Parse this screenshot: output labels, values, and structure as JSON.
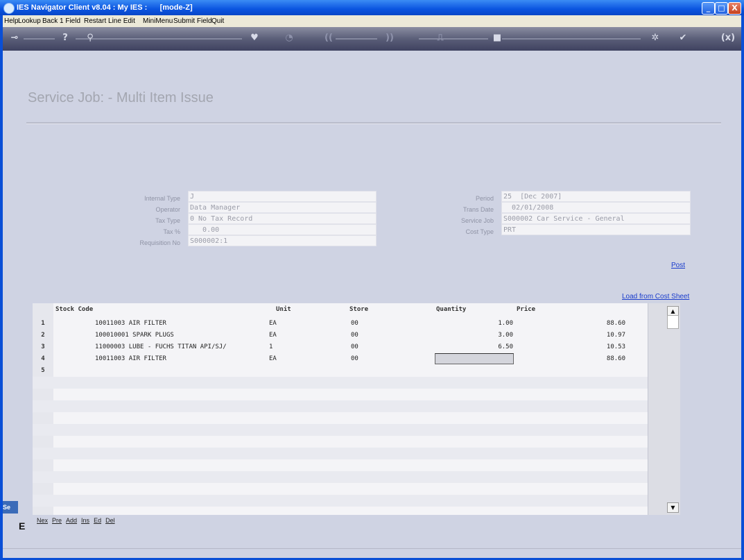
{
  "window": {
    "title": "IES Navigator Client v8.04 : My IES :      [mode-Z]",
    "minimize": "_",
    "maximize": "□",
    "close": "X"
  },
  "menu": [
    "Help",
    "Lookup",
    "Back 1 Field",
    "Restart Line Edit",
    "MiniMenu",
    "Submit Field",
    "Quit"
  ],
  "toolbar": {
    "help": "?",
    "previous": "((",
    "next": "))",
    "close": "(x)"
  },
  "page": {
    "title": "Service Job: - Multi Item Issue"
  },
  "form_left": [
    {
      "label": "Internal Type",
      "value": "J"
    },
    {
      "label": "Operator",
      "value": "Data Manager"
    },
    {
      "label": "Tax Type",
      "value": "0 No Tax Record"
    },
    {
      "label": "Tax %",
      "value": "   0.00"
    },
    {
      "label": "Requisition No",
      "value": "S000002:1"
    }
  ],
  "form_right": [
    {
      "label": "Period",
      "value": "25  [Dec 2007]"
    },
    {
      "label": "Trans Date",
      "value": "  02/01/2008"
    },
    {
      "label": "Service Job",
      "value": "S000002 Car Service - General"
    },
    {
      "label": "Cost Type",
      "value": "PRT"
    }
  ],
  "links": {
    "post": "Post",
    "load_from_cost_sheet": "Load from Cost Sheet"
  },
  "grid": {
    "headers": {
      "stock_code": "Stock Code",
      "unit": "Unit",
      "store": "Store",
      "quantity": "Quantity",
      "price": "Price"
    },
    "rows": [
      {
        "num": "1",
        "stock": "10011003 AIR FILTER",
        "unit": "EA",
        "store": "00",
        "qty": "1.00",
        "price": "88.60"
      },
      {
        "num": "2",
        "stock": "100010001 SPARK PLUGS",
        "unit": "EA",
        "store": "00",
        "qty": "3.00",
        "price": "10.97"
      },
      {
        "num": "3",
        "stock": "11000003 LUBE - FUCHS TITAN API/SJ/",
        "unit": "1",
        "store": "00",
        "qty": "6.50",
        "price": "10.53"
      },
      {
        "num": "4",
        "stock": "10011003 AIR FILTER",
        "unit": "EA",
        "store": "00",
        "qty": "",
        "price": "88.60"
      },
      {
        "num": "5",
        "stock": "",
        "unit": "",
        "store": "",
        "qty": "",
        "price": ""
      }
    ]
  },
  "row_buttons": [
    "Nex",
    "Pre",
    "Add",
    "Ins",
    "Ed",
    "Del"
  ],
  "sidetab": "Se",
  "sidemark": "E"
}
